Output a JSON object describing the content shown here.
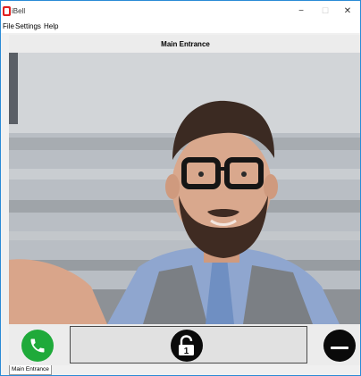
{
  "window": {
    "app_title": "iBell",
    "controls": {
      "minimize": "−",
      "maximize": "☐",
      "close": "✕"
    }
  },
  "menu": {
    "items": [
      "File",
      "Settings",
      "Help"
    ]
  },
  "header": {
    "title": "Main Entrance"
  },
  "video": {
    "icon": "camera-feed-person"
  },
  "controls": {
    "call_icon": "phone-icon",
    "unlock_icon": "unlock-1-icon",
    "unlock_badge": "1",
    "hangup_icon": "hangup-icon"
  },
  "tabs": {
    "active": "Main Entrance"
  },
  "colors": {
    "accent": "#2a8bd6",
    "call": "#1faa3a",
    "brand": "#e02020"
  }
}
